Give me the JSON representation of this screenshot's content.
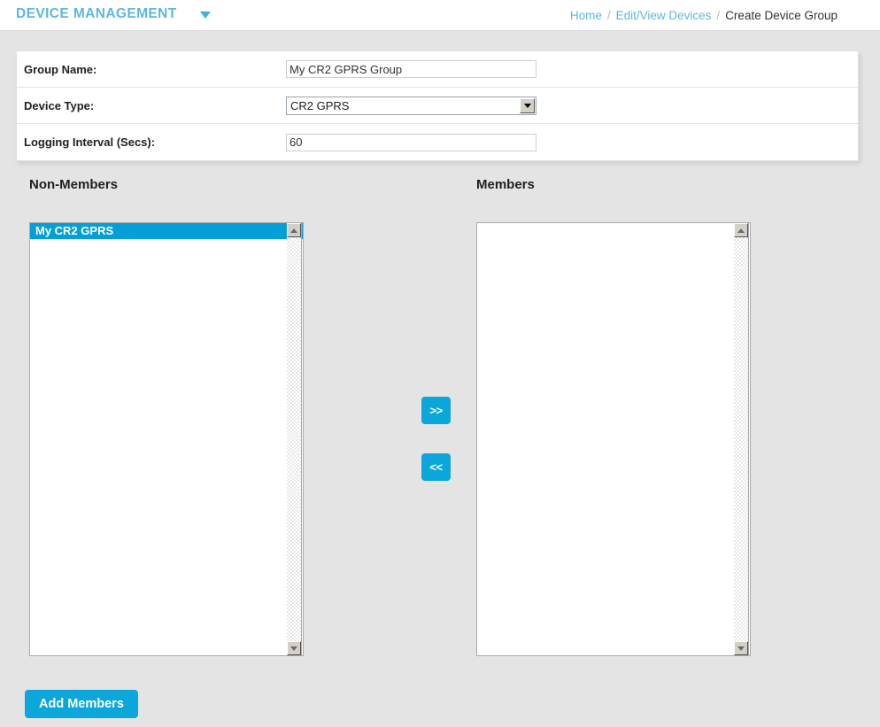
{
  "header": {
    "brand_title": "DEVICE MANAGEMENT",
    "caret_icon": "chevron-down-icon",
    "breadcrumb": {
      "items": [
        {
          "label": "Home",
          "current": false
        },
        {
          "label": "Edit/View Devices",
          "current": false
        },
        {
          "label": "Create Device Group",
          "current": true
        }
      ],
      "separator": "/"
    }
  },
  "form": {
    "rows": [
      {
        "label": "Group Name:",
        "value": "My CR2 GPRS Group",
        "placeholder": "",
        "type": "text"
      },
      {
        "label": "Device Type:",
        "value": "CR2 GPRS",
        "placeholder": "",
        "type": "select"
      },
      {
        "label": "Logging Interval (Secs):",
        "value": "60",
        "placeholder": "",
        "type": "text"
      }
    ]
  },
  "transfer": {
    "non_members": {
      "heading": "Non-Members",
      "options": [
        {
          "label": "My CR2 GPRS",
          "selected": true
        }
      ]
    },
    "members": {
      "heading": "Members",
      "options": []
    },
    "buttons": {
      "move_right_label": ">>",
      "move_left_label": "<<"
    },
    "scrollbar": {
      "up_icon": "triangle-up-icon",
      "down_icon": "triangle-down-icon"
    }
  },
  "actions": {
    "submit_label": "Add Members"
  },
  "colors": {
    "accent": "#0ba7db",
    "brand_text": "#5cb8e0",
    "selection": "#049fd9",
    "page_background": "#e4e4e4",
    "panel_background": "#ffffff"
  }
}
